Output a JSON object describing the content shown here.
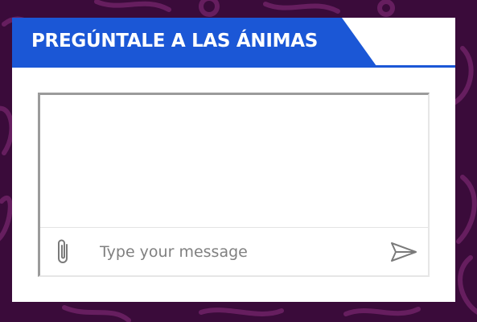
{
  "header": {
    "title": "PREGÚNTALE A LAS ÁNIMAS"
  },
  "chat": {
    "input_placeholder": "Type your message",
    "input_value": "",
    "attach_icon": "paperclip-icon",
    "send_icon": "send-icon"
  },
  "colors": {
    "accent": "#1b57d6",
    "background": "#3a0b3a",
    "pattern": "#7a2a6e"
  }
}
